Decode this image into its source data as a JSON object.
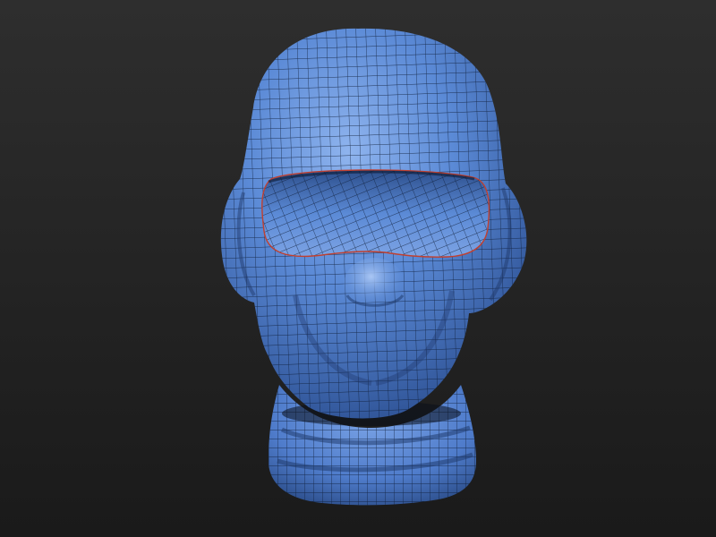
{
  "scene": {
    "background_top": "#2e2e2e",
    "background_bottom": "#1a1a1a",
    "model_color": "#5b8ad6",
    "model_shadow_color": "#2a4d8f",
    "model_highlight_color": "#8fb4ee",
    "wire_color": "#0d1a33",
    "seam_color": "#c04030",
    "model_subject": "balaclava-head-mesh"
  }
}
